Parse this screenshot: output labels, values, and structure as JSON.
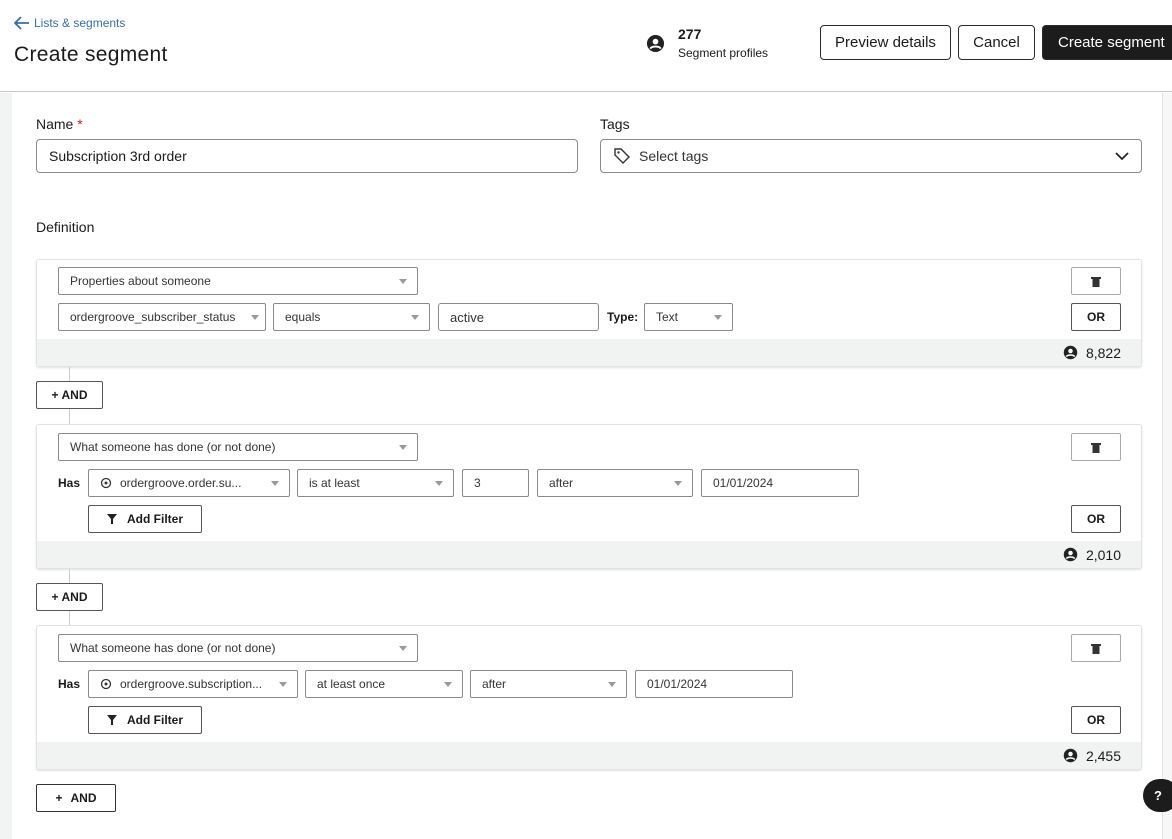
{
  "header": {
    "back_label": "Lists & segments",
    "title": "Create segment",
    "profile_count": "277",
    "profile_label": "Segment profiles",
    "preview_label": "Preview details",
    "cancel_label": "Cancel",
    "create_label": "Create segment"
  },
  "form": {
    "name_label": "Name",
    "required_mark": "*",
    "name_value": "Subscription 3rd order",
    "tags_label": "Tags",
    "tags_placeholder": "Select tags",
    "definition_label": "Definition"
  },
  "blocks": [
    {
      "type": "Properties about someone",
      "property": "ordergroove_subscriber_status",
      "operator": "equals",
      "value": "active",
      "type_label": "Type:",
      "value_type": "Text",
      "or_label": "OR",
      "count": "8,822"
    },
    {
      "type": "What someone has done (or not done)",
      "has_label": "Has",
      "metric": "ordergroove.order.su...",
      "operator": "is at least",
      "value": "3",
      "time_op": "after",
      "date": "01/01/2024",
      "filter_label": "Add Filter",
      "or_label": "OR",
      "count": "2,010"
    },
    {
      "type": "What someone has done (or not done)",
      "has_label": "Has",
      "metric": "ordergroove.subscription...",
      "operator": "at least once",
      "time_op": "after",
      "date": "01/01/2024",
      "filter_label": "Add Filter",
      "or_label": "OR",
      "count": "2,455"
    }
  ],
  "and_label": "AND",
  "plus": "+",
  "help_label": "?"
}
